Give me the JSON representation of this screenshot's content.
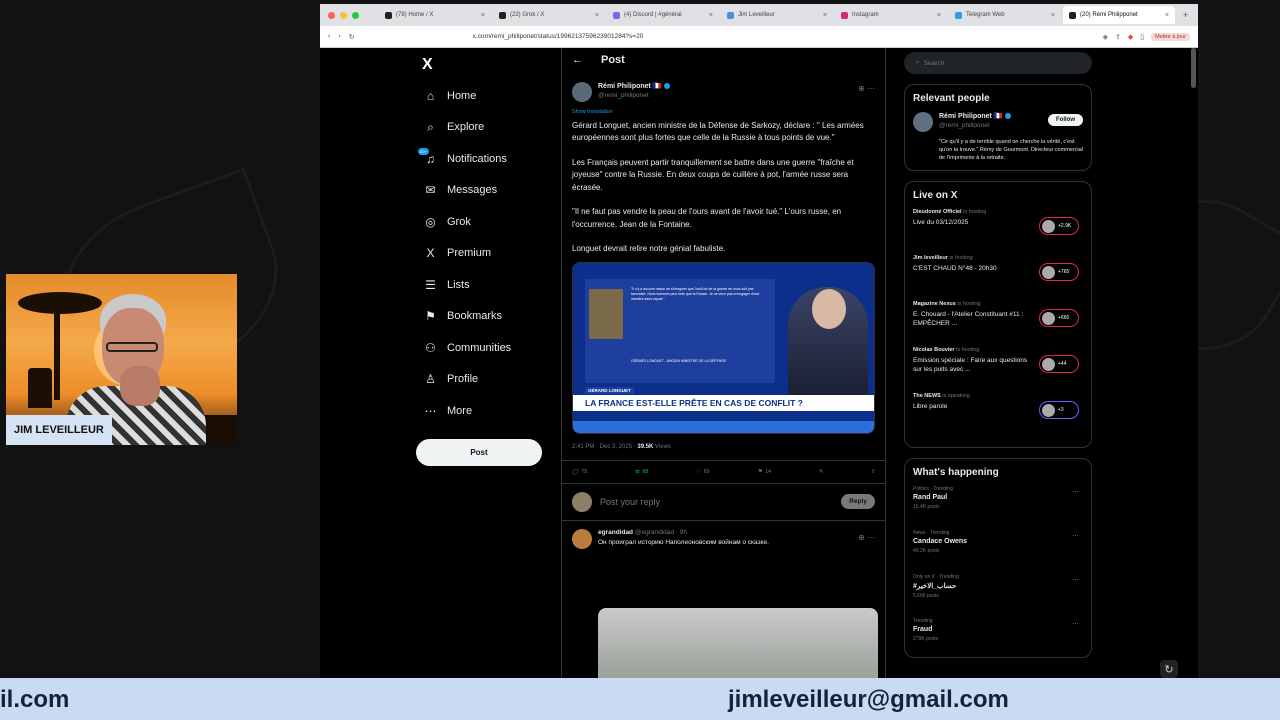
{
  "browser": {
    "tabs": [
      {
        "label": "(78) Home / X",
        "color": "#222222"
      },
      {
        "label": "(22) Grok / X",
        "color": "#222222"
      },
      {
        "label": "(4) Discord | #général",
        "color": "#7b68ee"
      },
      {
        "label": "Jim Leveilleur",
        "color": "#4a90d9"
      },
      {
        "label": "Instagram",
        "color": "#d6287a"
      },
      {
        "label": "Telegram Web",
        "color": "#2aa1de"
      },
      {
        "label": "(20) Rémi Philipponet",
        "color": "#222222",
        "active": true
      }
    ],
    "url": "x.com/remi_philiponet/status/1996213759623901284?s=20",
    "brave_label": "Mettre à jour"
  },
  "nav": {
    "logo": "X",
    "items": [
      {
        "label": "Home",
        "icon": "⌂"
      },
      {
        "label": "Explore",
        "icon": "⌕"
      },
      {
        "label": "Notifications",
        "icon": "♫",
        "badge": "20+"
      },
      {
        "label": "Messages",
        "icon": "✉"
      },
      {
        "label": "Grok",
        "icon": "◎"
      },
      {
        "label": "Premium",
        "icon": "X"
      },
      {
        "label": "Lists",
        "icon": "☰"
      },
      {
        "label": "Bookmarks",
        "icon": "⚑"
      },
      {
        "label": "Communities",
        "icon": "⚇"
      },
      {
        "label": "Profile",
        "icon": "♙"
      },
      {
        "label": "More",
        "icon": "⋯"
      }
    ],
    "post_button": "Post"
  },
  "post": {
    "header": "Post",
    "author_name": "Rémi Philiponet 🇫🇷",
    "author_handle": "@remi_philiponet",
    "translation_label": "Show translation",
    "paragraphs": [
      "Gérard Longuet, ancien ministre de la Défense de Sarkozy, déclare : \" Les armées européennes sont plus fortes que celle de la Russie à tous points de vue.\"",
      "Les Français peuvent partir tranquillement se battre dans une guerre \"fraîche et joyeuse\" contre la Russie. En deux coups de cuillère à pot, l'armée russe sera écrasée.",
      "\"Il ne faut pas vendre la peau de l'ours avant de l'avoir tué.\" L'ours russe, en l'occurrence. Jean de la Fontaine.",
      "Longuet devrait relire notre génial fabuliste."
    ],
    "media": {
      "quote": "\"Il n'y a aucune raison de s'imaginer que l'outil de de la guerre ne nous soit pas favorable. Nous sommes plus forts que la Russie. Je ne veux pas m'engager d'une manière sans espoir.\"",
      "quoter": "GÉRARD LONGUET - ANCIEN MINISTRE DE LA DÉFENSE",
      "tag": "GÉRARD LONGUET",
      "chyron": "LA FRANCE EST-ELLE PRÊTE EN CAS DE CONFLIT ?"
    },
    "timestamp": "2:41 PM · Dec 3, 2025 · ",
    "views": "39.5K",
    "views_label": " Views",
    "stats": {
      "replies": "75",
      "reposts": "98",
      "likes": "69",
      "bookmarks": "14"
    },
    "reply_placeholder": "Post your reply",
    "reply_button": "Reply",
    "reply": {
      "name": "egrandidad",
      "handle": "@egrandidad · 9h",
      "text": "Он проиграл историю Наполеоновским войнам о сказке."
    }
  },
  "right": {
    "search_placeholder": "Search",
    "relevant_title": "Relevant people",
    "relevant_name": "Rémi Philiponet 🇫🇷",
    "relevant_handle": "@remi_philiponet",
    "follow_label": "Follow",
    "relevant_bio": "\"Ce qu'il y a de terrible quand on cherche la vérité, c'est qu'on la trouve.\" Rémy de Gourmont. Directeur commercial de l'imprimerie à la retraite.",
    "live_title": "Live on X",
    "live": [
      {
        "host": "Dieudonné Officiel",
        "status": "is hosting",
        "title": "Live du 03/12/2025",
        "count": "+2.9K"
      },
      {
        "host": "Jim leveilleur",
        "status": "is hosting",
        "title": "C'EST CHAUD N°48 - 20h30",
        "count": "+765"
      },
      {
        "host": "Magazine Nexus",
        "status": "is hosting",
        "title": "E. Chouard - l'Atelier Constituant #11 : EMPÊCHER ...",
        "count": "+660"
      },
      {
        "host": "Nicolas Bouvier",
        "status": "is hosting",
        "title": "Emission spéciale : Faire aux questions sur les puits avec ...",
        "count": "+44"
      },
      {
        "host": "The NEWS",
        "status": "is speaking",
        "title": "Libre parole",
        "count": "+3"
      }
    ],
    "happening_title": "What's happening",
    "trends": [
      {
        "cat": "Politics · Trending",
        "name": "Rand Paul",
        "count": "15.4K posts"
      },
      {
        "cat": "News · Trending",
        "name": "Candace Owens",
        "count": "40.2K posts"
      },
      {
        "cat": "Only on X · Trending",
        "name": "#حساب_الاخير",
        "count": "5,666 posts"
      },
      {
        "cat": "Trending",
        "name": "Fraud",
        "count": "279K posts"
      }
    ]
  },
  "webcam": {
    "name": "JIM LEVEILLEUR"
  },
  "banner": {
    "email_left": "il.com",
    "email_right": "jimleveilleur@gmail.com"
  }
}
